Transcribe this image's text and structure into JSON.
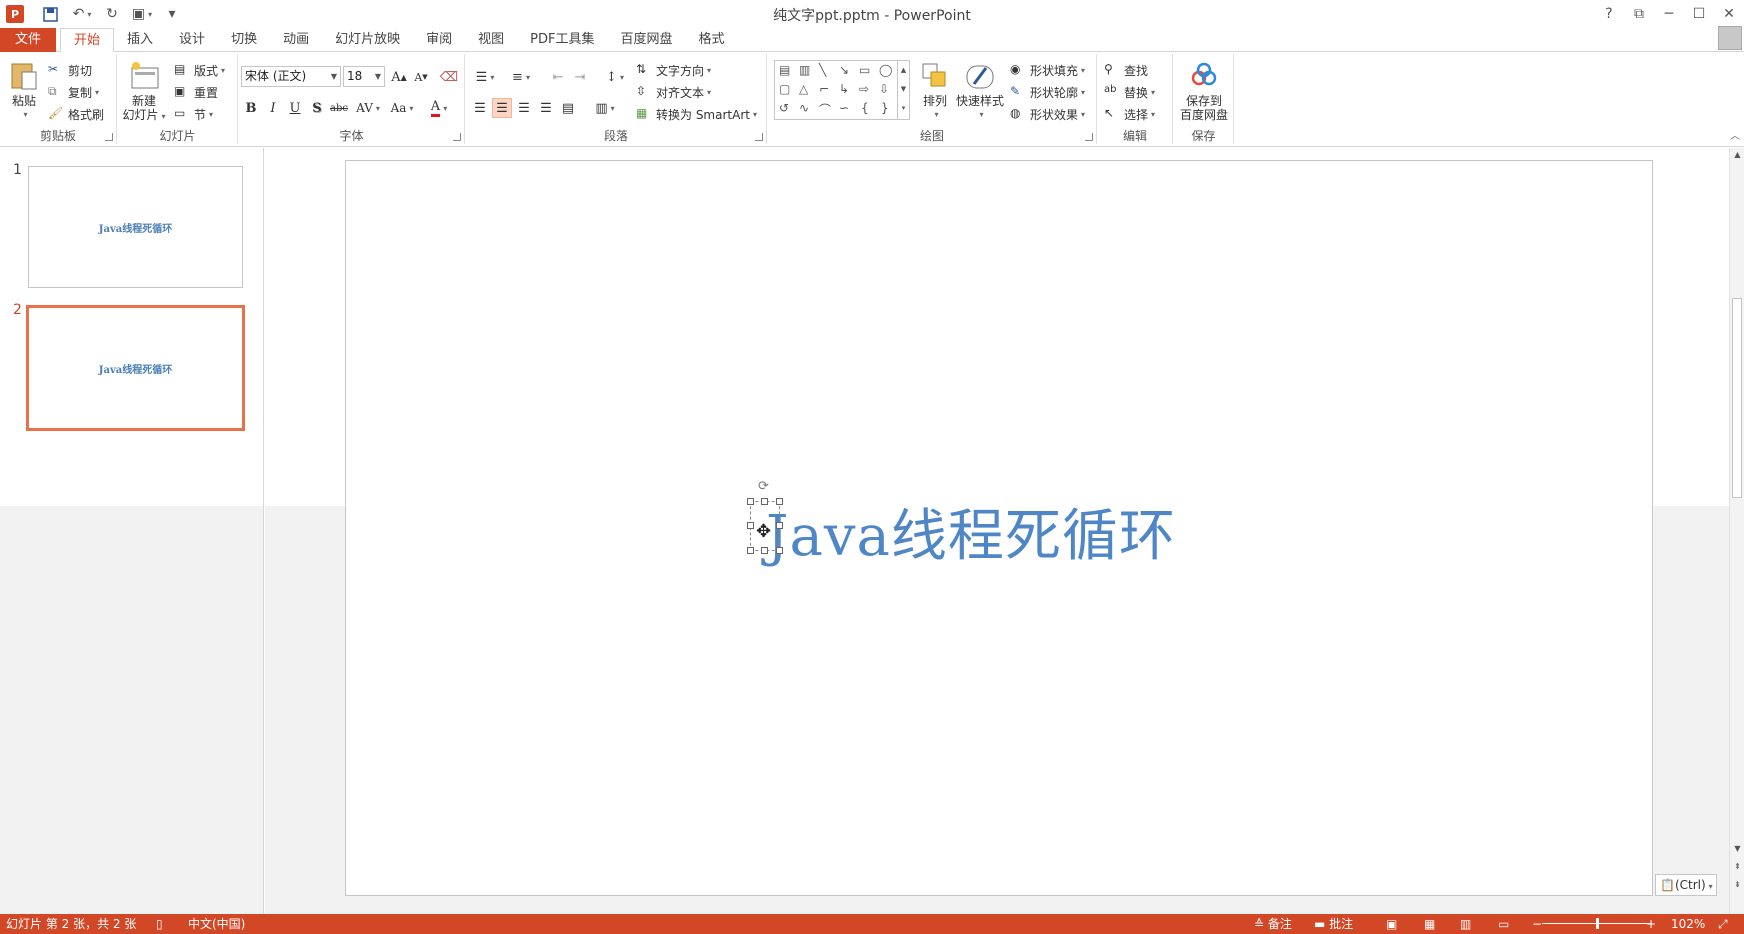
{
  "app": {
    "window_title": "纯文字ppt.pptm - PowerPoint",
    "help_label": "?",
    "file_tab": "文件",
    "tabs": [
      "开始",
      "插入",
      "设计",
      "切换",
      "动画",
      "幻灯片放映",
      "审阅",
      "视图",
      "PDF工具集",
      "百度网盘",
      "格式"
    ],
    "active_tab": "开始"
  },
  "ribbon": {
    "clipboard": {
      "group": "剪贴板",
      "paste": "粘贴",
      "cut": "剪切",
      "copy": "复制",
      "format_painter": "格式刷"
    },
    "slides": {
      "group": "幻灯片",
      "new_slide_1": "新建",
      "new_slide_2": "幻灯片",
      "layout": "版式",
      "reset": "重置",
      "section": "节"
    },
    "font": {
      "group": "字体",
      "font_name": "宋体 (正文)",
      "font_size": "18",
      "grow": "A",
      "shrink": "A",
      "bold": "B",
      "italic": "I",
      "underline": "U",
      "shadow": "S",
      "strike": "abc",
      "spacing": "AV",
      "case": "Aa",
      "color": "A"
    },
    "paragraph": {
      "group": "段落",
      "text_direction": "文字方向",
      "align_text": "对齐文本",
      "smartart": "转换为 SmartArt"
    },
    "drawing": {
      "group": "绘图",
      "arrange": "排列",
      "quick_styles": "快速样式",
      "shape_fill": "形状填充",
      "shape_outline": "形状轮廓",
      "shape_effects": "形状效果"
    },
    "editing": {
      "group": "编辑",
      "find": "查找",
      "replace": "替换",
      "select": "选择"
    },
    "save": {
      "group": "保存",
      "save_1": "保存到",
      "save_2": "百度网盘"
    }
  },
  "thumbnails": [
    {
      "number": "1",
      "text": "Java线程死循环",
      "selected": false
    },
    {
      "number": "2",
      "text": "Java线程死循环",
      "selected": true
    }
  ],
  "slide": {
    "title": "Java线程死循环"
  },
  "paste_options": "(Ctrl)",
  "status": {
    "slide_info": "幻灯片 第 2 张，共 2 张",
    "language": "中文(中国)",
    "notes": "备注",
    "comments": "批注",
    "zoom": "102%",
    "zoom_percent": 102
  },
  "colors": {
    "accent": "#d24726",
    "title_text": "#4f86c6",
    "selection": "#e97149"
  }
}
